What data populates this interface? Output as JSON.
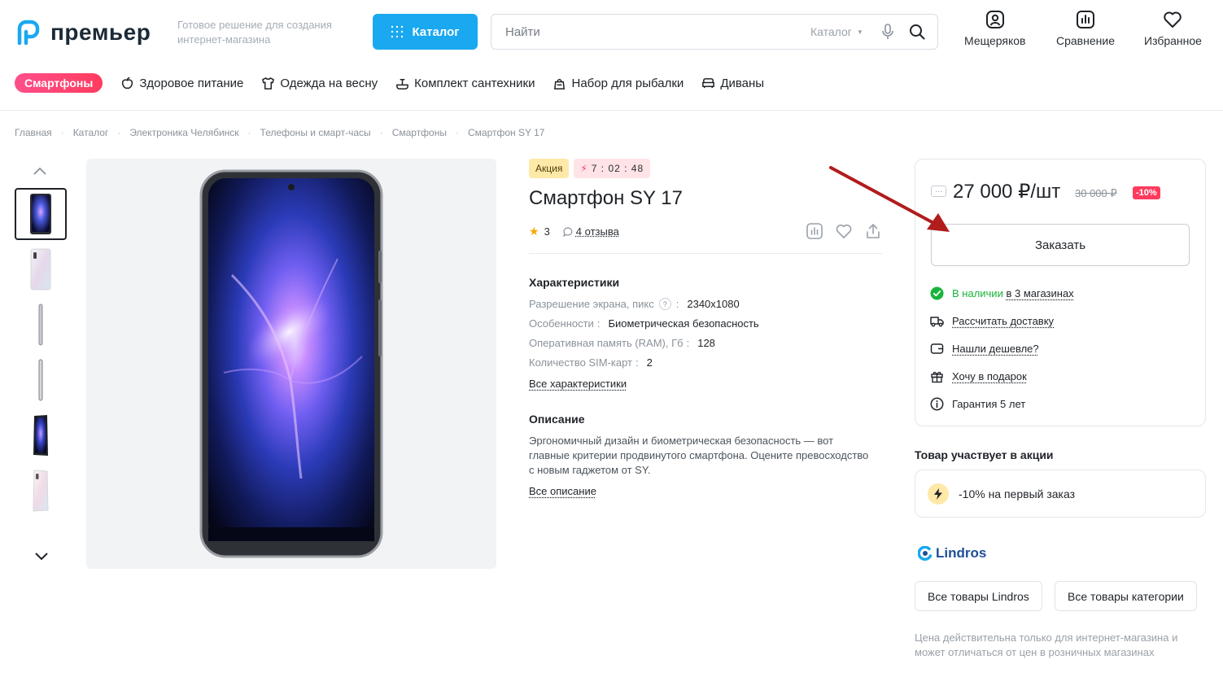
{
  "header": {
    "logo_text": "премьер",
    "tagline": "Готовое решение для создания интернет-магазина",
    "catalog_button": "Каталог",
    "search": {
      "placeholder": "Найти",
      "scope": "Каталог"
    },
    "actions": [
      {
        "label": "Мещеряков",
        "icon": "user-icon"
      },
      {
        "label": "Сравнение",
        "icon": "compare-icon"
      },
      {
        "label": "Избранное",
        "icon": "heart-icon"
      }
    ]
  },
  "category_nav": {
    "active": "Смартфоны",
    "items": [
      {
        "label": "Здоровое питание",
        "icon": "apple-icon"
      },
      {
        "label": "Одежда на весну",
        "icon": "shirt-icon"
      },
      {
        "label": "Комплект сантехники",
        "icon": "faucet-icon"
      },
      {
        "label": "Набор для рыбалки",
        "icon": "bag-icon"
      },
      {
        "label": "Диваны",
        "icon": "sofa-icon"
      }
    ]
  },
  "breadcrumb": [
    "Главная",
    "Каталог",
    "Электроника Челябинск",
    "Телефоны и смарт-часы",
    "Смартфоны",
    "Смартфон SY 17"
  ],
  "product": {
    "badge_sale": "Акция",
    "timer": "7 : 02 : 48",
    "title": "Смартфон SY 17",
    "rating": "3",
    "reviews": "4 отзыва",
    "characteristics_title": "Характеристики",
    "specs": [
      {
        "name": "Разрешение экрана, пикс",
        "value": "2340x1080",
        "help": true
      },
      {
        "name": "Особенности",
        "value": "Биометрическая безопасность",
        "help": false
      },
      {
        "name": "Оперативная память (RAM), Гб",
        "value": "128",
        "help": false
      },
      {
        "name": "Количество SIM-карт",
        "value": "2",
        "help": false
      }
    ],
    "all_specs_link": "Все характеристики",
    "description_title": "Описание",
    "description": "Эргономичный дизайн и биометрическая безопасность — вот главные критерии продвинутого смартфона. Оцените превосходство с новым гаджетом от SY.",
    "all_description_link": "Все описание"
  },
  "buybox": {
    "price_menu": "···",
    "price": "27 000 ₽/шт",
    "old_price": "30 000 ₽",
    "discount": "-10%",
    "order_button": "Заказать",
    "stock_label": "В наличии",
    "stock_link": "в 3 магазинах",
    "delivery": "Рассчитать доставку",
    "cheaper": "Нашли дешевле?",
    "gift": "Хочу в подарок",
    "warranty": "Гарантия 5 лет"
  },
  "promo": {
    "title": "Товар участвует в акции",
    "offer": "-10% на первый заказ"
  },
  "brand": {
    "name": "Lindros",
    "all_brand_button": "Все товары Lindros",
    "all_category_button": "Все товары категории"
  },
  "note": "Цена действительна только для интернет-магазина и может отличаться от цен в розничных магазинах",
  "colors": {
    "accent": "#1aa8f0",
    "sale": "#ff3b5e",
    "in_stock": "#19b43a",
    "annotation_arrow": "#b11c1c"
  }
}
